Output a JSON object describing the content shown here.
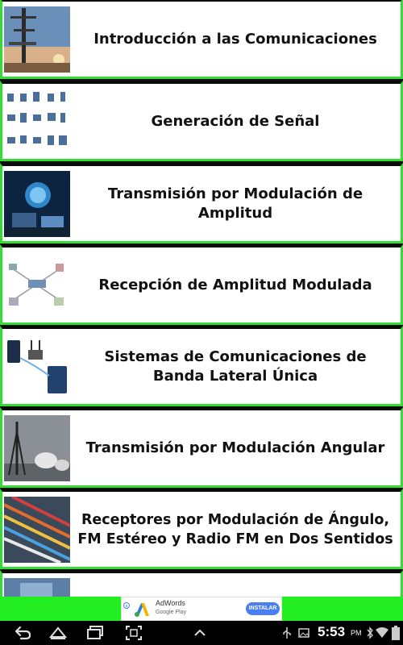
{
  "list": {
    "items": [
      {
        "label": "Introducción a las Comunicaciones",
        "icon": "antenna-tower-photo"
      },
      {
        "label": "Generación de Señal",
        "icon": "device-icons-grid"
      },
      {
        "label": "Transmisión por Modulación de Amplitud",
        "icon": "tech-globe-laptop"
      },
      {
        "label": "Recepción de Amplitud Modulada",
        "icon": "network-diagram"
      },
      {
        "label": "Sistemas de Comunicaciones de Banda Lateral Única",
        "icon": "phone-tablet-router"
      },
      {
        "label": "Transmisión por Modulación Angular",
        "icon": "satellite-dishes"
      },
      {
        "label": "Receptores por Modulación de Ángulo, FM Estéreo y Radio FM en Dos Sentidos",
        "icon": "fiber-cables"
      },
      {
        "label": "",
        "icon": "partial-photo"
      }
    ]
  },
  "ad": {
    "brand": "AdWords",
    "store": "Google Play",
    "install_label": "INSTALAR"
  },
  "status": {
    "time": "5:53",
    "ampm": "PM"
  },
  "colors": {
    "accent_green": "#33dd33",
    "ad_banner_green": "#22ee22",
    "install_blue": "#4a7ef5"
  }
}
